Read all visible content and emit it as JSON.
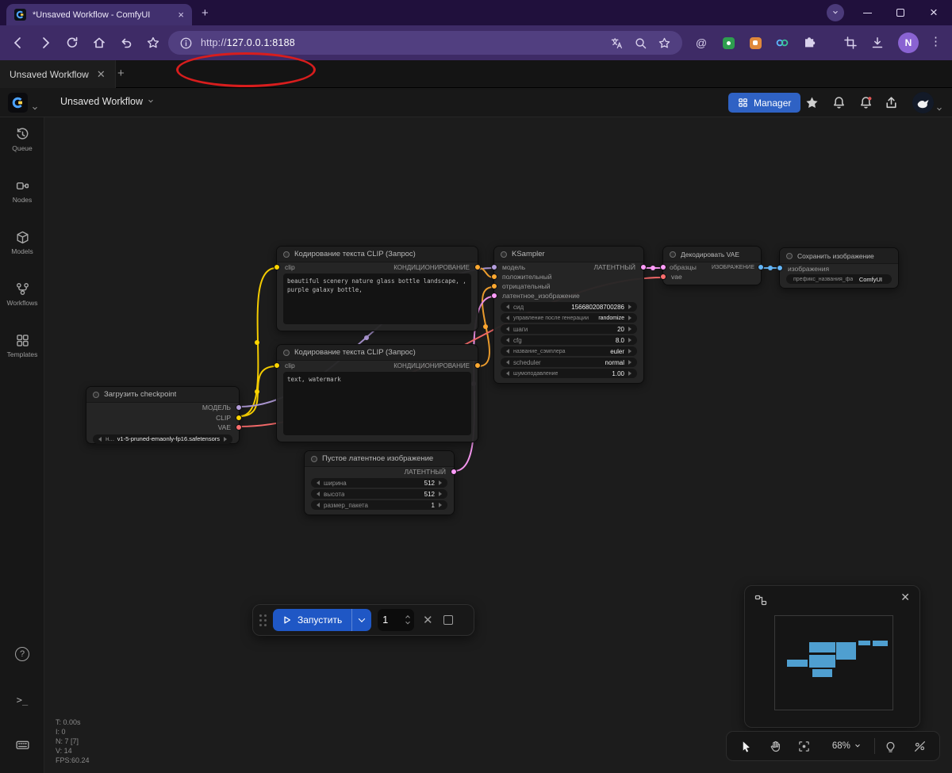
{
  "browser": {
    "tab_title": "*Unsaved Workflow - ComfyUI",
    "url": {
      "protocol": "http://",
      "host": "127.0.0.1:8188"
    },
    "profile_initial": "N"
  },
  "workflow_tabs": {
    "active_label": "Unsaved Workflow"
  },
  "app_header": {
    "workflow_title": "Unsaved Workflow",
    "manager_label": "Manager"
  },
  "sidebar": {
    "items": [
      {
        "label": "Queue"
      },
      {
        "label": "Nodes"
      },
      {
        "label": "Models"
      },
      {
        "label": "Workflows"
      },
      {
        "label": "Templates"
      }
    ]
  },
  "colors": {
    "model": "#B39DDB",
    "clip": "#FFD500",
    "vae": "#FF6E6E",
    "conditioning": "#FFA931",
    "latent": "#FF9CF9",
    "image": "#64B5F6",
    "accent_blue": "#2f62c4",
    "annotation_red": "#d81d1d",
    "minimap_node": "#4f9fd0"
  },
  "nodes": {
    "checkpoint": {
      "title": "Загрузить checkpoint",
      "outputs": {
        "model": "МОДЕЛЬ",
        "clip": "CLIP",
        "vae": "VAE"
      },
      "widget": {
        "label": "н...",
        "value": "v1-5-pruned-emaonly-fp16.safetensors"
      }
    },
    "clip_positive": {
      "title": "Кодирование текста CLIP (Запрос)",
      "input": "clip",
      "output": "КОНДИЦИОНИРОВАНИЕ",
      "text": "beautiful scenery nature glass bottle landscape, , purple galaxy bottle,"
    },
    "clip_negative": {
      "title": "Кодирование текста CLIP (Запрос)",
      "input": "clip",
      "output": "КОНДИЦИОНИРОВАНИЕ",
      "text": "text, watermark"
    },
    "empty_latent": {
      "title": "Пустое латентное изображение",
      "output": "ЛАТЕНТНЫЙ",
      "widgets": [
        {
          "label": "ширина",
          "value": "512"
        },
        {
          "label": "высота",
          "value": "512"
        },
        {
          "label": "размер_пакета",
          "value": "1"
        }
      ]
    },
    "ksampler": {
      "title": "KSampler",
      "inputs": [
        "модель",
        "положительный",
        "отрицательный",
        "латентное_изображение"
      ],
      "output": "ЛАТЕНТНЫЙ",
      "widgets": [
        {
          "label": "сид",
          "value": "156680208700286"
        },
        {
          "label": "управление после генерации",
          "value": "randomize"
        },
        {
          "label": "шаги",
          "value": "20"
        },
        {
          "label": "cfg",
          "value": "8.0"
        },
        {
          "label": "название_сэмплера",
          "value": "euler"
        },
        {
          "label": "scheduler",
          "value": "normal"
        },
        {
          "label": "шумоподавление",
          "value": "1.00"
        }
      ]
    },
    "vae_decode": {
      "title": "Декодировать VAE",
      "inputs": [
        "образцы",
        "vae"
      ],
      "output": "ИЗОБРАЖЕНИЕ"
    },
    "save_image": {
      "title": "Сохранить изображение",
      "input": "изображения",
      "widget": {
        "label": "префикс_названия_фа",
        "value": "ComfyUI"
      }
    }
  },
  "run_bar": {
    "run_label": "Запустить",
    "batch_count": "1"
  },
  "view_controls": {
    "zoom": "68%"
  },
  "stats": {
    "lines": [
      "T: 0.00s",
      "I: 0",
      "N: 7 [7]",
      "V: 14",
      "FPS:60.24"
    ]
  }
}
